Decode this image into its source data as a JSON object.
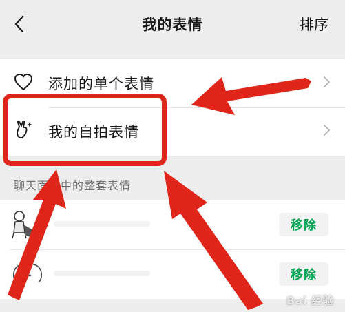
{
  "nav": {
    "title": "我的表情",
    "sort_label": "排序"
  },
  "menu": {
    "items": [
      {
        "label": "添加的单个表情",
        "icon": "heart-icon"
      },
      {
        "label": "我的自拍表情",
        "icon": "selfie-hand-icon"
      }
    ]
  },
  "section": {
    "title": "聊天面板中的整套表情"
  },
  "packs": [
    {
      "remove_label": "移除"
    },
    {
      "remove_label": "移除"
    }
  ],
  "annotation": {
    "color": "#e0261b"
  },
  "watermark": "Bai 经验"
}
